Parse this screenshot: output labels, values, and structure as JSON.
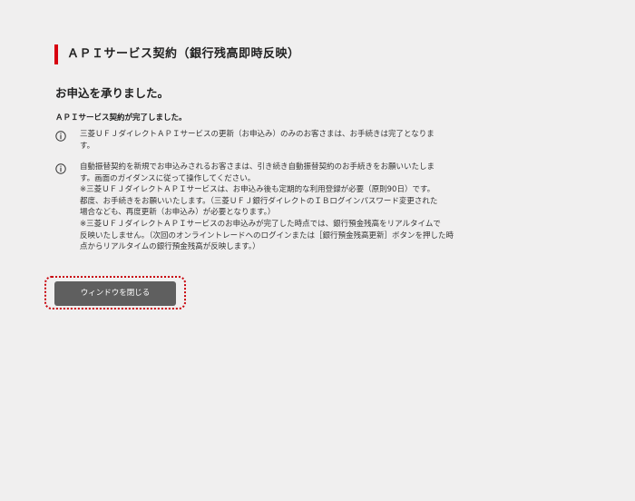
{
  "page": {
    "title": "ＡＰＩサービス契約（銀行残高即時反映）",
    "heading": "お申込を承りました。",
    "lead": "ＡＰＩサービス契約が完了しました。"
  },
  "notices": [
    {
      "icon": "info-icon",
      "lines": [
        "三菱ＵＦＪダイレクトＡＰＩサービスの更新（お申込み）のみのお客さまは、お手続きは完了となりま",
        "す。"
      ]
    },
    {
      "icon": "info-icon",
      "lines": [
        "自動振替契約を新規でお申込みされるお客さまは、引き続き自動振替契約のお手続きをお願いいたしま",
        "す。画面のガイダンスに従って操作してください。",
        "※三菱ＵＦＪダイレクトＡＰＩサービスは、お申込み後も定期的な利用登録が必要（原則90日）です。",
        "都度、お手続きをお願いいたします。（三菱ＵＦＪ銀行ダイレクトのＩＢログインパスワード変更された",
        "場合なども、再度更新（お申込み）が必要となります。）",
        "※三菱ＵＦＪダイレクトＡＰＩサービスのお申込みが完了した時点では、銀行預金残高をリアルタイムで",
        "反映いたしません。（次回のオンライントレードへのログインまたは［銀行預金残高更新］ボタンを押した時",
        "点からリアルタイムの銀行預金残高が反映します。）"
      ]
    }
  ],
  "actions": {
    "close_label": "ウィンドウを閉じる"
  },
  "colors": {
    "accent": "#d7000f",
    "background": "#f0efef",
    "button": "#5f5f5f",
    "highlight_frame": "#c8000a"
  }
}
